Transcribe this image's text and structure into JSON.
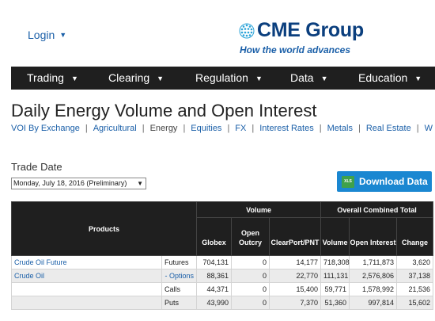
{
  "header": {
    "login_label": "Login",
    "logo_name": "CME Group",
    "logo_tagline": "How the world advances",
    "logo_color": "#0b3f7e"
  },
  "nav": {
    "items": [
      {
        "label": "Trading"
      },
      {
        "label": "Clearing"
      },
      {
        "label": "Regulation"
      },
      {
        "label": "Data"
      },
      {
        "label": "Education"
      }
    ]
  },
  "page": {
    "title": "Daily Energy Volume and Open Interest"
  },
  "subnav": {
    "items": [
      {
        "label": "VOI By Exchange"
      },
      {
        "label": "Agricultural"
      },
      {
        "label": "Energy",
        "current": true
      },
      {
        "label": "Equities"
      },
      {
        "label": "FX"
      },
      {
        "label": "Interest Rates"
      },
      {
        "label": "Metals"
      },
      {
        "label": "Real Estate"
      },
      {
        "label": "W"
      }
    ],
    "separator": "|"
  },
  "trade_date": {
    "label": "Trade Date",
    "selected": "Monday, July 18, 2016 (Preliminary)"
  },
  "download": {
    "label": "Download Data",
    "icon_text": "XLS"
  },
  "table": {
    "products_header": "Products",
    "volume_header": "Volume",
    "occ_header": "Overall Combined Total",
    "columns": [
      "Globex",
      "Open Outcry",
      "ClearPort/PNT",
      "Volume",
      "Open Interest",
      "Change"
    ],
    "rows": [
      {
        "product": "Crude Oil Future",
        "type": "Futures",
        "type_link": false,
        "globex": "704,131",
        "outcry": "0",
        "clearport": "14,177",
        "volume": "718,308",
        "oi": "1,711,873",
        "change": "3,620"
      },
      {
        "product": "Crude Oil",
        "type": "- Options",
        "type_link": true,
        "globex": "88,361",
        "outcry": "0",
        "clearport": "22,770",
        "volume": "111,131",
        "oi": "2,576,806",
        "change": "37,138"
      },
      {
        "product": "",
        "type": "Calls",
        "type_link": false,
        "globex": "44,371",
        "outcry": "0",
        "clearport": "15,400",
        "volume": "59,771",
        "oi": "1,578,992",
        "change": "21,536"
      },
      {
        "product": "",
        "type": "Puts",
        "type_link": false,
        "globex": "43,990",
        "outcry": "0",
        "clearport": "7,370",
        "volume": "51,360",
        "oi": "997,814",
        "change": "15,602"
      }
    ]
  }
}
